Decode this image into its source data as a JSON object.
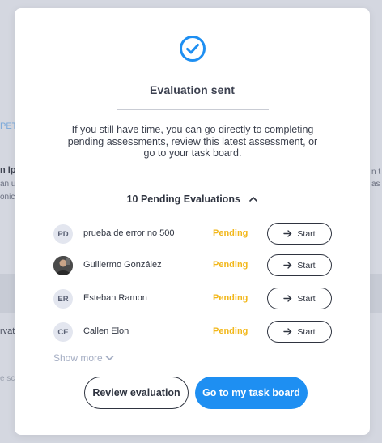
{
  "background": {
    "fragments": [
      "PET",
      "n Ip",
      "an u",
      "onic",
      "rvat",
      "e sc",
      "n t",
      "as"
    ]
  },
  "modal": {
    "icon": "check-circle-icon",
    "title": "Evaluation sent",
    "description": "If you still have time, you can go directly to completing pending assessments, review this latest assessment, or go to your task board.",
    "pending_header": "10 Pending Evaluations",
    "evaluations": [
      {
        "initials": "PD",
        "name": "prueba de error no 500",
        "status": "Pending",
        "action": "Start"
      },
      {
        "initials": "",
        "name": "Guillermo González",
        "status": "Pending",
        "action": "Start"
      },
      {
        "initials": "ER",
        "name": "Esteban Ramon",
        "status": "Pending",
        "action": "Start"
      },
      {
        "initials": "CE",
        "name": "Callen Elon",
        "status": "Pending",
        "action": "Start"
      }
    ],
    "show_more": "Show more",
    "review_button": "Review evaluation",
    "task_board_button": "Go to my task board"
  },
  "colors": {
    "accent": "#1e8ff2",
    "pending": "#f2b71a",
    "overlay": "#d4d7e0"
  }
}
